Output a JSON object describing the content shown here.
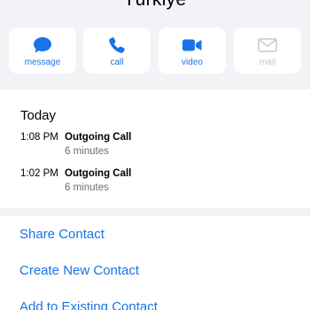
{
  "contact": {
    "name": "Türkiye"
  },
  "actions": [
    {
      "label": "message",
      "icon": "message-bubble-icon",
      "enabled": true
    },
    {
      "label": "call",
      "icon": "phone-icon",
      "enabled": true
    },
    {
      "label": "video",
      "icon": "video-camera-icon",
      "enabled": true
    },
    {
      "label": "mail",
      "icon": "envelope-icon",
      "enabled": false
    }
  ],
  "recents": {
    "title": "Today",
    "calls": [
      {
        "time": "1:08 PM",
        "type": "Outgoing Call",
        "duration": "6 minutes"
      },
      {
        "time": "1:02 PM",
        "type": "Outgoing Call",
        "duration": "6 minutes"
      }
    ]
  },
  "links": {
    "share": "Share Contact",
    "create": "Create New Contact",
    "add_existing": "Add to Existing Contact"
  },
  "colors": {
    "accent": "#1a73e8",
    "disabled": "#c7c7cc",
    "background": "#f2f2f7",
    "secondary_text": "#6d6d72"
  }
}
